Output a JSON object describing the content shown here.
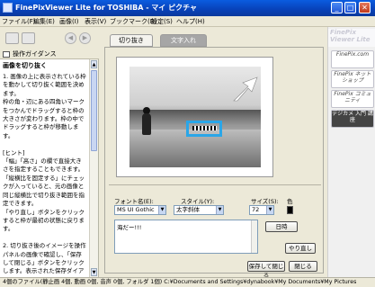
{
  "window": {
    "title": "FinePixViewer Lite for TOSHIBA - マイ ピクチャ"
  },
  "menu": [
    "ファイル(F)",
    "編集(E)",
    "画像(I)",
    "表示(V)",
    "ブックマーク(B)",
    "設定(S)",
    "ヘルプ(H)"
  ],
  "guide": {
    "header": "操作ガイダンス",
    "subtitle": "画像を切り抜く",
    "body": "1. 画像の上に表示されている枠を動かして切り抜く範囲を決めます。\n枠の角・辺にある四角いマークをつかんでドラッグすると枠の大きさが変わります。枠の中でドラッグすると枠が移動します。\n\n[ヒント]\n「幅」「高さ」の欄で直接大きさを指定することもできます。「縦横比を固定する」にチェックが入っていると、元の画像と同じ縦横比で切り抜き範囲を指定できます。\n「やり直し」ボタンをクリックすると枠が最初の状態に戻ります。\n\n2. 切り抜き後のイメージを操作パネルの画像で確認し、「保存して閉じる」ボタンをクリックします。表示された保存ダイアログで保存先とファイル名を指定して保存します。"
  },
  "tabs": [
    {
      "label": "切り抜き",
      "active": false
    },
    {
      "label": "文字入れ",
      "active": true
    }
  ],
  "options": {
    "font_label": "フォント名(E):",
    "font_value": "MS UI Gothic",
    "style_label": "スタイル(Y):",
    "style_value": "太字斜体",
    "size_label": "サイズ(S):",
    "size_value": "72",
    "color_label": "色",
    "color_value": "#000000",
    "date_button": "日時",
    "text_value": "海だー!!!"
  },
  "buttons": {
    "undo": "やり直し",
    "save_close": "保存して閉じる",
    "close": "閉じる"
  },
  "right_panel": {
    "brand": "FinePix Viewer Lite",
    "items": [
      {
        "label": "FinePix.com"
      },
      {
        "label": "FinePix ネットショップ"
      },
      {
        "label": "FinePix コミュニティ"
      },
      {
        "label": "デジカメ 入門 講座"
      }
    ]
  },
  "status": "4個のファイル(静止画 4個, 動画 0個, 音声 0個, フォルダ 1個)   C:¥Documents and Settings¥dynabook¥My Documents¥My Pictures",
  "colors": {
    "title_bar": "#0a5ce0",
    "selection_box": "#2aa6e8",
    "active_tab": "#a6a6a6"
  }
}
